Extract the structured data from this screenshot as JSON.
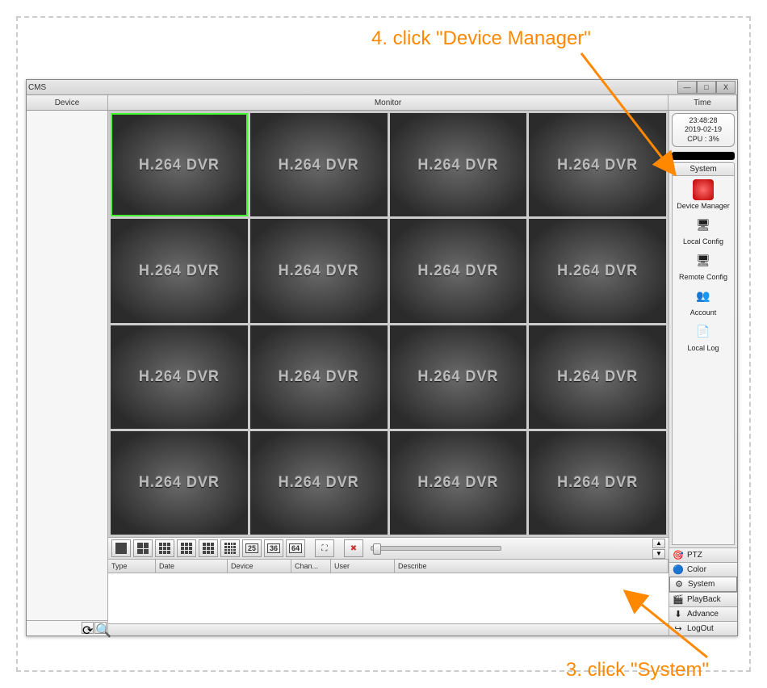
{
  "annotations": {
    "top": "4. click \"Device Manager\"",
    "bottom": "3. click \"System\""
  },
  "window": {
    "title": "CMS",
    "btn_min": "—",
    "btn_max": "□",
    "btn_close": "X"
  },
  "header": {
    "device": "Device",
    "monitor": "Monitor",
    "time": "Time"
  },
  "clock": {
    "time": "23:48:28",
    "date": "2019-02-19",
    "cpu": "CPU : 3%"
  },
  "video": {
    "cell_label": "H.264 DVR"
  },
  "layout_numbers": {
    "n25": "25",
    "n36": "36",
    "n64": "64"
  },
  "system_panel": {
    "tab": "System",
    "items": [
      {
        "label": "Device Manager",
        "icon": "🔴"
      },
      {
        "label": "Local Config",
        "icon": "🖥"
      },
      {
        "label": "Remote Config",
        "icon": "🖥"
      },
      {
        "label": "Account",
        "icon": "👥"
      },
      {
        "label": "Local Log",
        "icon": "📄"
      }
    ]
  },
  "bottom_tabs": [
    {
      "label": "PTZ",
      "icon": "🎯"
    },
    {
      "label": "Color",
      "icon": "🔵"
    },
    {
      "label": "System",
      "icon": "⚙"
    },
    {
      "label": "PlayBack",
      "icon": "🎬"
    },
    {
      "label": "Advance",
      "icon": "⬇"
    },
    {
      "label": "LogOut",
      "icon": "↪"
    }
  ],
  "log_columns": {
    "type": "Type",
    "date": "Date",
    "device": "Device",
    "chan": "Chan...",
    "user": "User",
    "describe": "Describe"
  }
}
